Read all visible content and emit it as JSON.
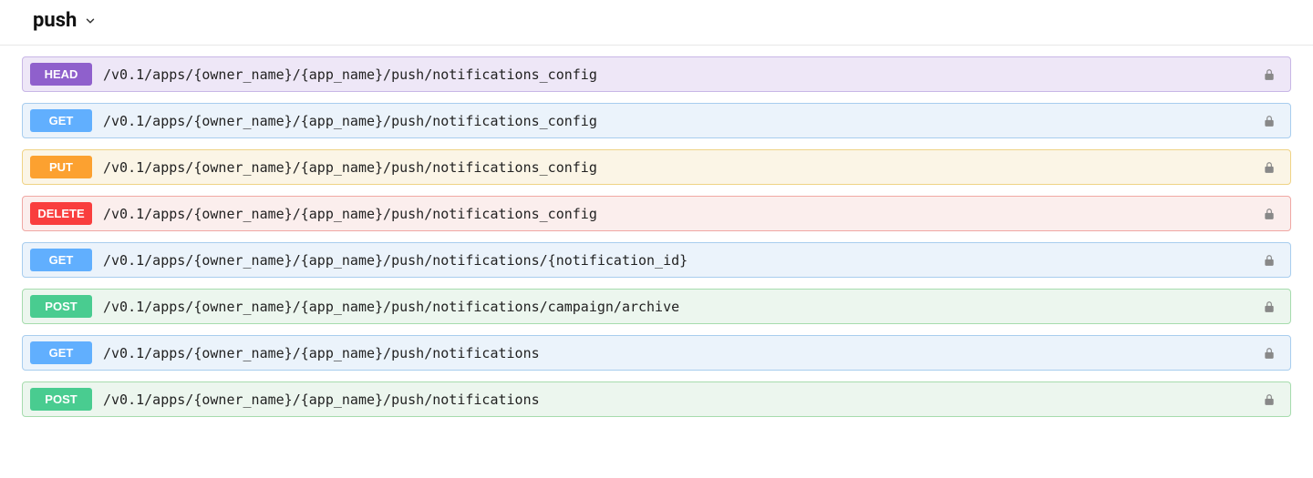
{
  "section": {
    "title": "push"
  },
  "methods": {
    "HEAD": {
      "label": "HEAD",
      "cls": "m-head"
    },
    "GET": {
      "label": "GET",
      "cls": "m-get"
    },
    "PUT": {
      "label": "PUT",
      "cls": "m-put"
    },
    "DELETE": {
      "label": "DELETE",
      "cls": "m-delete"
    },
    "POST": {
      "label": "POST",
      "cls": "m-post"
    }
  },
  "operations": [
    {
      "method": "HEAD",
      "path": "/v0.1/apps/{owner_name}/{app_name}/push/notifications_config",
      "locked": true
    },
    {
      "method": "GET",
      "path": "/v0.1/apps/{owner_name}/{app_name}/push/notifications_config",
      "locked": true
    },
    {
      "method": "PUT",
      "path": "/v0.1/apps/{owner_name}/{app_name}/push/notifications_config",
      "locked": true
    },
    {
      "method": "DELETE",
      "path": "/v0.1/apps/{owner_name}/{app_name}/push/notifications_config",
      "locked": true
    },
    {
      "method": "GET",
      "path": "/v0.1/apps/{owner_name}/{app_name}/push/notifications/{notification_id}",
      "locked": true
    },
    {
      "method": "POST",
      "path": "/v0.1/apps/{owner_name}/{app_name}/push/notifications/campaign/archive",
      "locked": true
    },
    {
      "method": "GET",
      "path": "/v0.1/apps/{owner_name}/{app_name}/push/notifications",
      "locked": true
    },
    {
      "method": "POST",
      "path": "/v0.1/apps/{owner_name}/{app_name}/push/notifications",
      "locked": true
    }
  ]
}
